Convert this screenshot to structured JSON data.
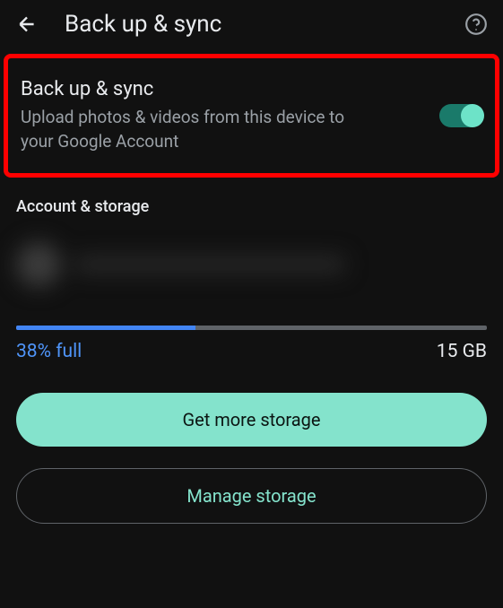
{
  "header": {
    "title": "Back up & sync"
  },
  "backup_toggle": {
    "title": "Back up & sync",
    "description": "Upload photos & videos from this device to your Google Account",
    "enabled": true
  },
  "section": {
    "label": "Account & storage"
  },
  "storage": {
    "percent_label": "38% full",
    "percent_value": 38,
    "total_label": "15 GB"
  },
  "buttons": {
    "get_more": "Get more storage",
    "manage": "Manage storage"
  },
  "colors": {
    "accent": "#84e3cc",
    "progress": "#4285f4",
    "highlight": "#ff0000"
  }
}
